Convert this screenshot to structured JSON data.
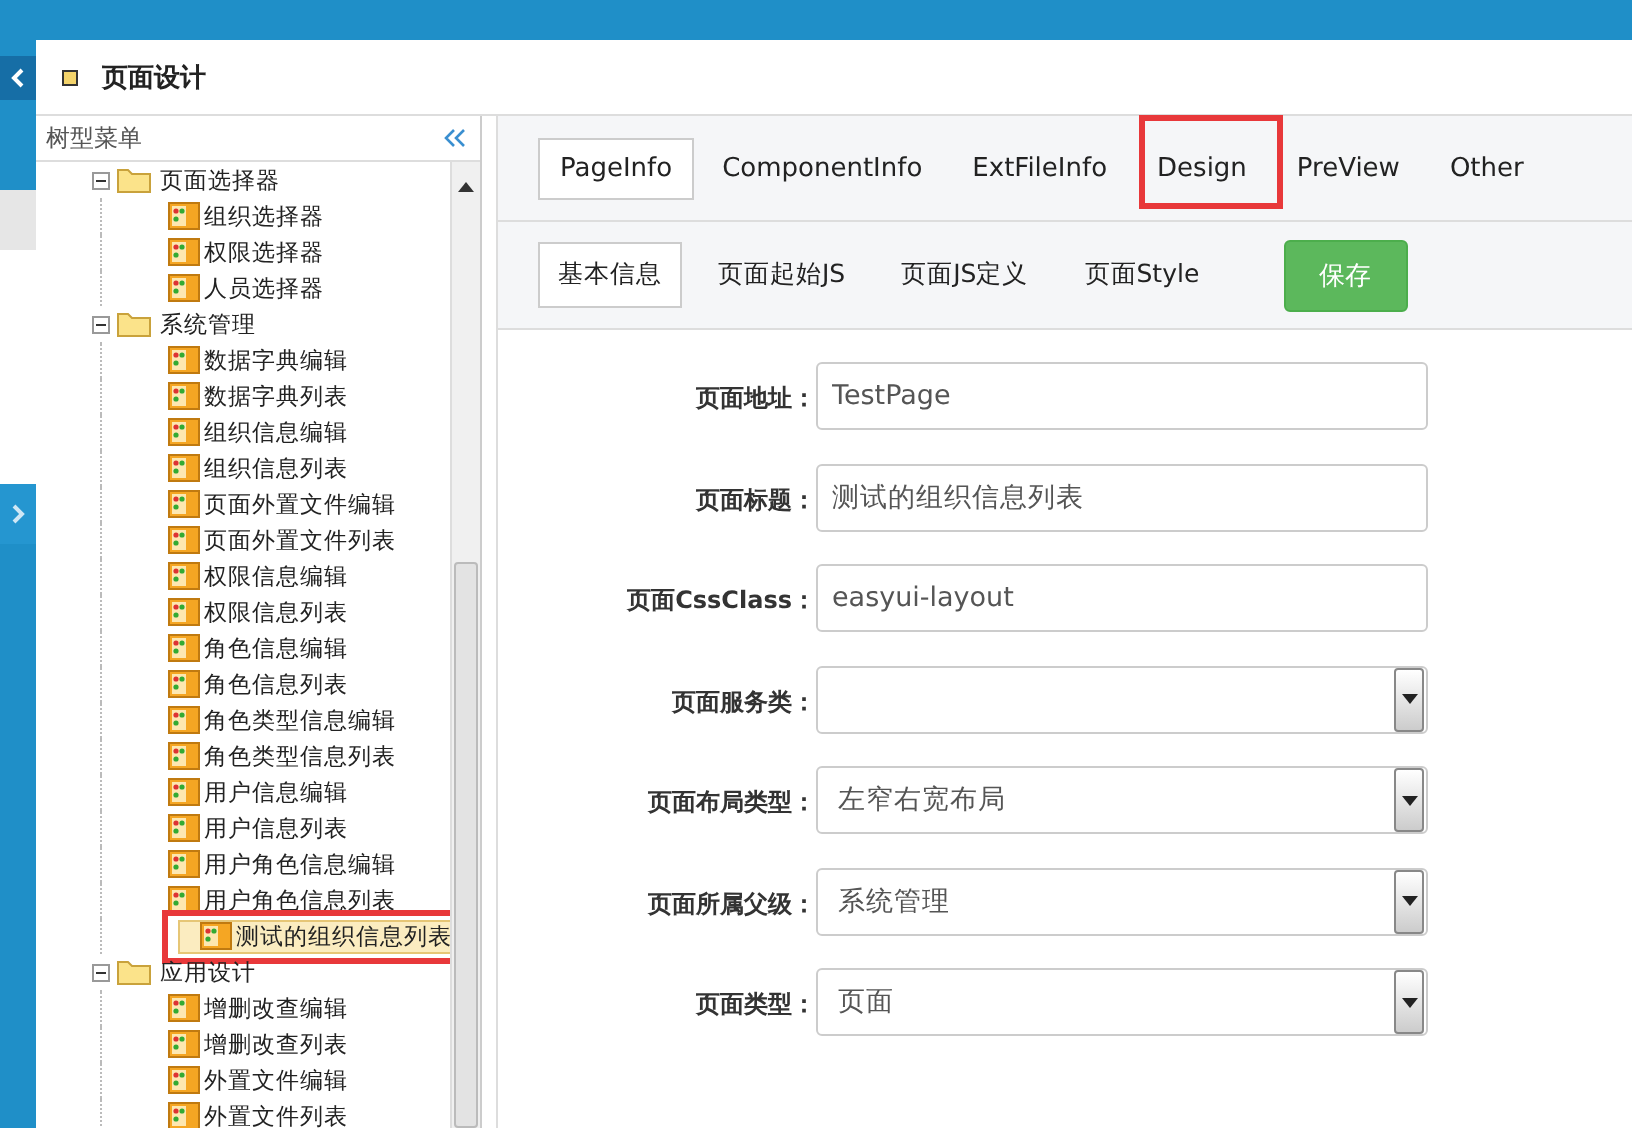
{
  "header": {
    "title": "页面设计"
  },
  "tree": {
    "title": "树型菜单",
    "nodes": [
      {
        "label": "页面选择器",
        "expanded": true,
        "children": [
          {
            "label": "组织选择器",
            "selected": false
          },
          {
            "label": "权限选择器",
            "selected": false
          },
          {
            "label": "人员选择器",
            "selected": false
          }
        ]
      },
      {
        "label": "系统管理",
        "expanded": true,
        "children": [
          {
            "label": "数据字典编辑",
            "selected": false
          },
          {
            "label": "数据字典列表",
            "selected": false
          },
          {
            "label": "组织信息编辑",
            "selected": false
          },
          {
            "label": "组织信息列表",
            "selected": false
          },
          {
            "label": "页面外置文件编辑",
            "selected": false
          },
          {
            "label": "页面外置文件列表",
            "selected": false
          },
          {
            "label": "权限信息编辑",
            "selected": false
          },
          {
            "label": "权限信息列表",
            "selected": false
          },
          {
            "label": "角色信息编辑",
            "selected": false
          },
          {
            "label": "角色信息列表",
            "selected": false
          },
          {
            "label": "角色类型信息编辑",
            "selected": false
          },
          {
            "label": "角色类型信息列表",
            "selected": false
          },
          {
            "label": "用户信息编辑",
            "selected": false
          },
          {
            "label": "用户信息列表",
            "selected": false
          },
          {
            "label": "用户角色信息编辑",
            "selected": false
          },
          {
            "label": "用户角色信息列表",
            "selected": false
          },
          {
            "label": "测试的组织信息列表",
            "selected": true
          }
        ]
      },
      {
        "label": "应用设计",
        "expanded": true,
        "children": [
          {
            "label": "增删改查编辑",
            "selected": false
          },
          {
            "label": "增删改查列表",
            "selected": false
          },
          {
            "label": "外置文件编辑",
            "selected": false
          },
          {
            "label": "外置文件列表",
            "selected": false
          }
        ]
      }
    ]
  },
  "tabs": [
    {
      "label": "PageInfo",
      "selected": true
    },
    {
      "label": "ComponentInfo",
      "selected": false
    },
    {
      "label": "ExtFileInfo",
      "selected": false
    },
    {
      "label": "Design",
      "selected": false
    },
    {
      "label": "PreView",
      "selected": false
    },
    {
      "label": "Other",
      "selected": false
    }
  ],
  "subtabs": [
    {
      "label": "基本信息",
      "selected": true
    },
    {
      "label": "页面起始JS",
      "selected": false
    },
    {
      "label": "页面JS定义",
      "selected": false
    },
    {
      "label": "页面Style",
      "selected": false
    }
  ],
  "save_button": "保存",
  "form": [
    {
      "label": "页面地址：",
      "kind": "text",
      "value": "TestPage"
    },
    {
      "label": "页面标题：",
      "kind": "text",
      "value": "测试的组织信息列表"
    },
    {
      "label": "页面CssClass：",
      "kind": "text",
      "value": "easyui-layout"
    },
    {
      "label": "页面服务类：",
      "kind": "select"
    },
    {
      "label": "页面布局类型：",
      "kind": "select",
      "value": "左窄右宽布局"
    },
    {
      "label": "页面所属父级：",
      "kind": "select",
      "value": "系统管理"
    },
    {
      "label": "页面类型：",
      "kind": "select",
      "value": "页面"
    }
  ]
}
